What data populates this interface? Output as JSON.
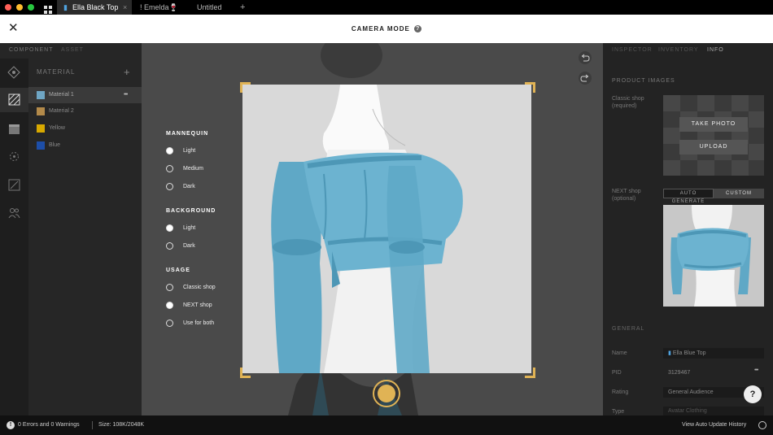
{
  "tabs": [
    {
      "label": "Ella Black Top"
    },
    {
      "label": "! Emelda🍷"
    },
    {
      "label": "Untitled"
    }
  ],
  "tab_close_symbol": "×",
  "tab_add_symbol": "+",
  "header": {
    "title": "CAMERA MODE",
    "help_symbol": "?",
    "close_symbol": "✕"
  },
  "left": {
    "tabs": {
      "component": "COMPONENT",
      "asset": "ASSET"
    },
    "material_title": "MATERIAL",
    "add_symbol": "+",
    "more_symbol": "•••",
    "materials": [
      {
        "label": "Material 1",
        "color": "#6fa6c4"
      },
      {
        "label": "Material 2",
        "color": "#b38a4a"
      },
      {
        "label": "Yellow",
        "color": "#d8a900"
      },
      {
        "label": "Blue",
        "color": "#1d4ea8"
      }
    ]
  },
  "camera_options": {
    "mannequin_title": "MANNEQUIN",
    "mannequin": [
      "Light",
      "Medium",
      "Dark"
    ],
    "background_title": "BACKGROUND",
    "background": [
      "Light",
      "Dark"
    ],
    "usage_title": "USAGE",
    "usage": [
      "Classic shop",
      "NEXT shop",
      "Use for both"
    ]
  },
  "right": {
    "tabs": {
      "inspector": "INSPECTOR",
      "inventory": "INVENTORY",
      "info": "INFO"
    },
    "product_images": "PRODUCT IMAGES",
    "classic_shop": "Classic shop",
    "classic_required": "(required)",
    "take_photo": "TAKE PHOTO",
    "upload": "UPLOAD",
    "next_shop": "NEXT shop",
    "next_optional": "(optional)",
    "auto_generate": "AUTO GENERATE",
    "custom": "CUSTOM",
    "general": "GENERAL",
    "fields": {
      "name_label": "Name",
      "name_value": "Ella Blue Top",
      "pid_label": "PID",
      "pid_value": "3129467",
      "rating_label": "Rating",
      "rating_value": "General Audience",
      "type_label": "Type",
      "type_value": "Avatar Clothing"
    },
    "more_symbol": "•••",
    "help_symbol": "?"
  },
  "status": {
    "errors": "0 Errors and 0 Warnings",
    "size": "Size: 108K/2048K",
    "history": "View Auto Update History"
  },
  "colors": {
    "accent": "#e0b355",
    "garment": "#5fa8c6"
  }
}
